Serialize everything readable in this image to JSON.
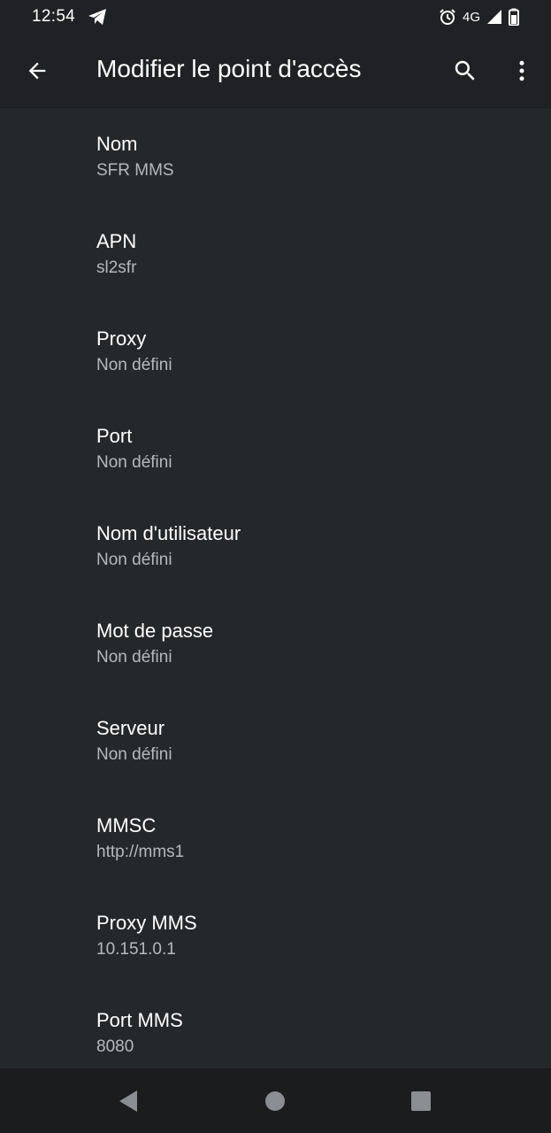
{
  "status_bar": {
    "time": "12:54",
    "network": "4G",
    "icons": [
      "telegram-icon",
      "alarm-icon",
      "signal-icon",
      "battery-icon"
    ]
  },
  "app_bar": {
    "title": "Modifier le point d'accès",
    "icons": [
      "back-arrow-icon",
      "search-icon",
      "more-vert-icon"
    ]
  },
  "preferences": [
    {
      "title": "Nom",
      "summary": "SFR MMS"
    },
    {
      "title": "APN",
      "summary": "sl2sfr"
    },
    {
      "title": "Proxy",
      "summary": "Non défini"
    },
    {
      "title": "Port",
      "summary": "Non défini"
    },
    {
      "title": "Nom d'utilisateur",
      "summary": "Non défini"
    },
    {
      "title": "Mot de passe",
      "summary": "Non défini"
    },
    {
      "title": "Serveur",
      "summary": "Non défini"
    },
    {
      "title": "MMSC",
      "summary": "http://mms1"
    },
    {
      "title": "Proxy MMS",
      "summary": "10.151.0.1"
    },
    {
      "title": "Port MMS",
      "summary": "8080"
    }
  ],
  "nav_bar": {
    "icons": [
      "nav-back-icon",
      "nav-home-icon",
      "nav-recents-icon"
    ]
  },
  "colors": {
    "background": "#202124",
    "content_background": "#25282b",
    "title_text": "#ffffff",
    "summary_text": "#b5b8bc",
    "nav_bar": "#1b1c1e"
  }
}
